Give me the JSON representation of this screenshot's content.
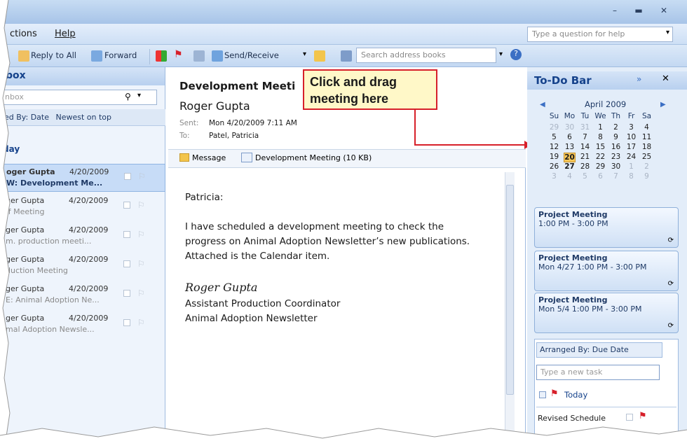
{
  "menu": {
    "actions": "ctions",
    "help": "Help",
    "help_placeholder": "Type a question for help"
  },
  "toolbar": {
    "reply_all": "Reply to All",
    "forward": "Forward",
    "send_receive": "Send/Receive",
    "search_placeholder": "Search address books"
  },
  "inbox": {
    "title": "box",
    "search_placeholder": "nbox",
    "arranged_by": "ed By: Date",
    "sort_order": "Newest on top",
    "group": "day",
    "rows": [
      {
        "from": "oger Gupta",
        "date": "4/20/2009",
        "subject": "W: Development Me..."
      },
      {
        "from": "ger Gupta",
        "date": "4/20/2009",
        "subject": "ff Meeting"
      },
      {
        "from": "ger Gupta",
        "date": "4/20/2009",
        "subject": "m. production meeti..."
      },
      {
        "from": "ger Gupta",
        "date": "4/20/2009",
        "subject": "duction Meeting"
      },
      {
        "from": "ger Gupta",
        "date": "4/20/2009",
        "subject": "E: Animal Adoption Ne..."
      },
      {
        "from": "ger Gupta",
        "date": "4/20/2009",
        "subject": "mal Adoption Newsle..."
      }
    ]
  },
  "message": {
    "subject": "Development Meeti",
    "sender": "Roger Gupta",
    "sent_label": "Sent:",
    "sent_value": "Mon 4/20/2009 7:11 AM",
    "to_label": "To:",
    "to_value": "Patel, Patricia",
    "tab_message": "Message",
    "tab_attachment": "Development Meeting (10 KB)",
    "greeting": "Patricia:",
    "body_line1": "I have scheduled a development meeting to check the",
    "body_line2": "progress on Animal Adoption Newsletter’s new publications.",
    "body_line3": "Attached is the Calendar item.",
    "signature": "Roger Gupta",
    "sig_title": "Assistant Production Coordinator",
    "sig_org": "Animal Adoption Newsletter"
  },
  "callout": {
    "line1": "Click and drag",
    "line2": "meeting here"
  },
  "todo": {
    "title": "To-Do Bar",
    "month": "April 2009",
    "weekdays": [
      "Su",
      "Mo",
      "Tu",
      "We",
      "Th",
      "Fr",
      "Sa"
    ],
    "weeks": [
      [
        "29",
        "30",
        "31",
        "1",
        "2",
        "3",
        "4"
      ],
      [
        "5",
        "6",
        "7",
        "8",
        "9",
        "10",
        "11"
      ],
      [
        "12",
        "13",
        "14",
        "15",
        "16",
        "17",
        "18"
      ],
      [
        "19",
        "20",
        "21",
        "22",
        "23",
        "24",
        "25"
      ],
      [
        "26",
        "27",
        "28",
        "29",
        "30",
        "1",
        "2"
      ],
      [
        "3",
        "4",
        "5",
        "6",
        "7",
        "8",
        "9"
      ]
    ],
    "appointments": [
      {
        "title": "Project Meeting",
        "time": "1:00 PM - 3:00 PM"
      },
      {
        "title": "Project Meeting",
        "time": "Mon 4/27 1:00 PM - 3:00 PM"
      },
      {
        "title": "Project Meeting",
        "time": "Mon 5/4 1:00 PM - 3:00 PM"
      }
    ],
    "tasks_arranged": "Arranged By: Due Date",
    "new_task_placeholder": "Type a new task",
    "today_label": "Today",
    "task_item": "Revised Schedule"
  },
  "colors": {
    "accent": "#15428b",
    "callout_border": "#d7202a",
    "today_highlight": "#f6c75a"
  }
}
